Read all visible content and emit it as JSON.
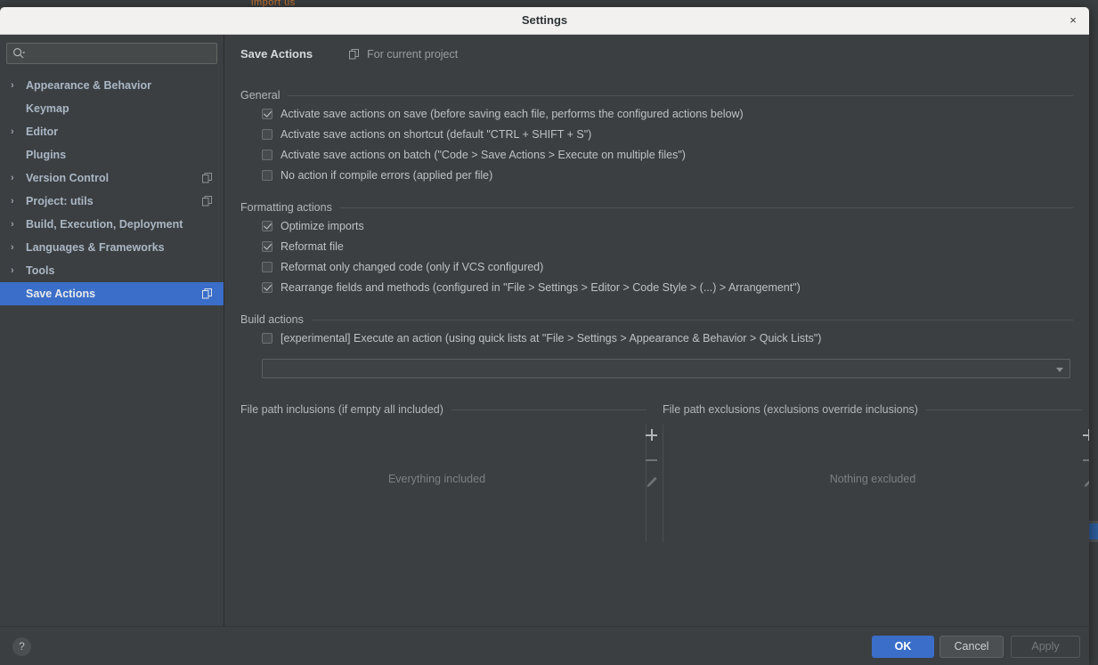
{
  "backdrop": {
    "ide_tab_text": "import us"
  },
  "window": {
    "title": "Settings",
    "close_label": "×"
  },
  "search": {
    "value": "",
    "placeholder": "",
    "icon": "search-icon"
  },
  "sidebar": {
    "items": [
      {
        "label": "Appearance & Behavior",
        "expandable": true,
        "selected": false,
        "has_copy_icon": false
      },
      {
        "label": "Keymap",
        "expandable": false,
        "selected": false,
        "has_copy_icon": false
      },
      {
        "label": "Editor",
        "expandable": true,
        "selected": false,
        "has_copy_icon": false
      },
      {
        "label": "Plugins",
        "expandable": false,
        "selected": false,
        "has_copy_icon": false
      },
      {
        "label": "Version Control",
        "expandable": true,
        "selected": false,
        "has_copy_icon": true
      },
      {
        "label": "Project: utils",
        "expandable": true,
        "selected": false,
        "has_copy_icon": true
      },
      {
        "label": "Build, Execution, Deployment",
        "expandable": true,
        "selected": false,
        "has_copy_icon": false
      },
      {
        "label": "Languages & Frameworks",
        "expandable": true,
        "selected": false,
        "has_copy_icon": false
      },
      {
        "label": "Tools",
        "expandable": true,
        "selected": false,
        "has_copy_icon": false
      },
      {
        "label": "Save Actions",
        "expandable": false,
        "selected": true,
        "has_copy_icon": true
      }
    ]
  },
  "pane": {
    "title": "Save Actions",
    "scope": "For current project",
    "scope_icon": "project-scope-icon"
  },
  "sections": {
    "general": {
      "title": "General",
      "checkboxes": [
        {
          "label": "Activate save actions on save (before saving each file, performs the configured actions below)",
          "checked": true
        },
        {
          "label": "Activate save actions on shortcut (default \"CTRL + SHIFT + S\")",
          "checked": false
        },
        {
          "label": "Activate save actions on batch (\"Code > Save Actions > Execute on multiple files\")",
          "checked": false
        },
        {
          "label": "No action if compile errors (applied per file)",
          "checked": false
        }
      ]
    },
    "formatting": {
      "title": "Formatting actions",
      "checkboxes": [
        {
          "label": "Optimize imports",
          "checked": true
        },
        {
          "label": "Reformat file",
          "checked": true
        },
        {
          "label": "Reformat only changed code (only if VCS configured)",
          "checked": false
        },
        {
          "label": "Rearrange fields and methods (configured in \"File > Settings > Editor > Code Style > (...) > Arrangement\")",
          "checked": true
        }
      ]
    },
    "build": {
      "title": "Build actions",
      "checkboxes": [
        {
          "label": "[experimental] Execute an action (using quick lists at \"File > Settings > Appearance & Behavior > Quick Lists\")",
          "checked": false
        }
      ],
      "quick_list_select": {
        "value": "",
        "enabled": false
      }
    }
  },
  "paths": {
    "inclusions": {
      "title": "File path inclusions (if empty all included)",
      "empty_text": "Everything included",
      "tools": {
        "add": "+",
        "remove": "−",
        "edit": "pencil-icon"
      }
    },
    "exclusions": {
      "title": "File path exclusions (exclusions override inclusions)",
      "empty_text": "Nothing excluded",
      "tools": {
        "add": "+",
        "remove": "−",
        "edit": "pencil-icon"
      }
    }
  },
  "footer": {
    "help_label": "?",
    "ok_label": "OK",
    "cancel_label": "Cancel",
    "apply_label": "Apply",
    "apply_enabled": false
  },
  "colors": {
    "dialog_bg": "#3c3f41",
    "titlebar_bg": "#f2f1f0",
    "accent": "#3a6ec9",
    "text": "#bfc2c4",
    "muted_text": "#7c8083"
  }
}
